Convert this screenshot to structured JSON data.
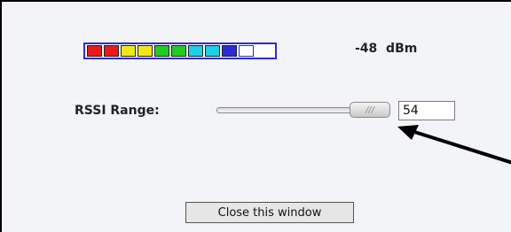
{
  "signal_meter": {
    "segments": [
      {
        "color": "#e81a1a",
        "filled": true
      },
      {
        "color": "#e81a1a",
        "filled": true
      },
      {
        "color": "#f2e61a",
        "filled": true
      },
      {
        "color": "#f2e61a",
        "filled": true
      },
      {
        "color": "#22cc22",
        "filled": true
      },
      {
        "color": "#22cc22",
        "filled": true
      },
      {
        "color": "#1ecfe6",
        "filled": true
      },
      {
        "color": "#1ecfe6",
        "filled": true
      },
      {
        "color": "#2b2bd8",
        "filled": true
      },
      {
        "color": "#2b2bd8",
        "filled": false
      }
    ],
    "reading": "-48  dBm"
  },
  "rssi": {
    "label": "RSSI Range:",
    "value": "54",
    "handle_grip": "///"
  },
  "close_button_label": "Close this window"
}
